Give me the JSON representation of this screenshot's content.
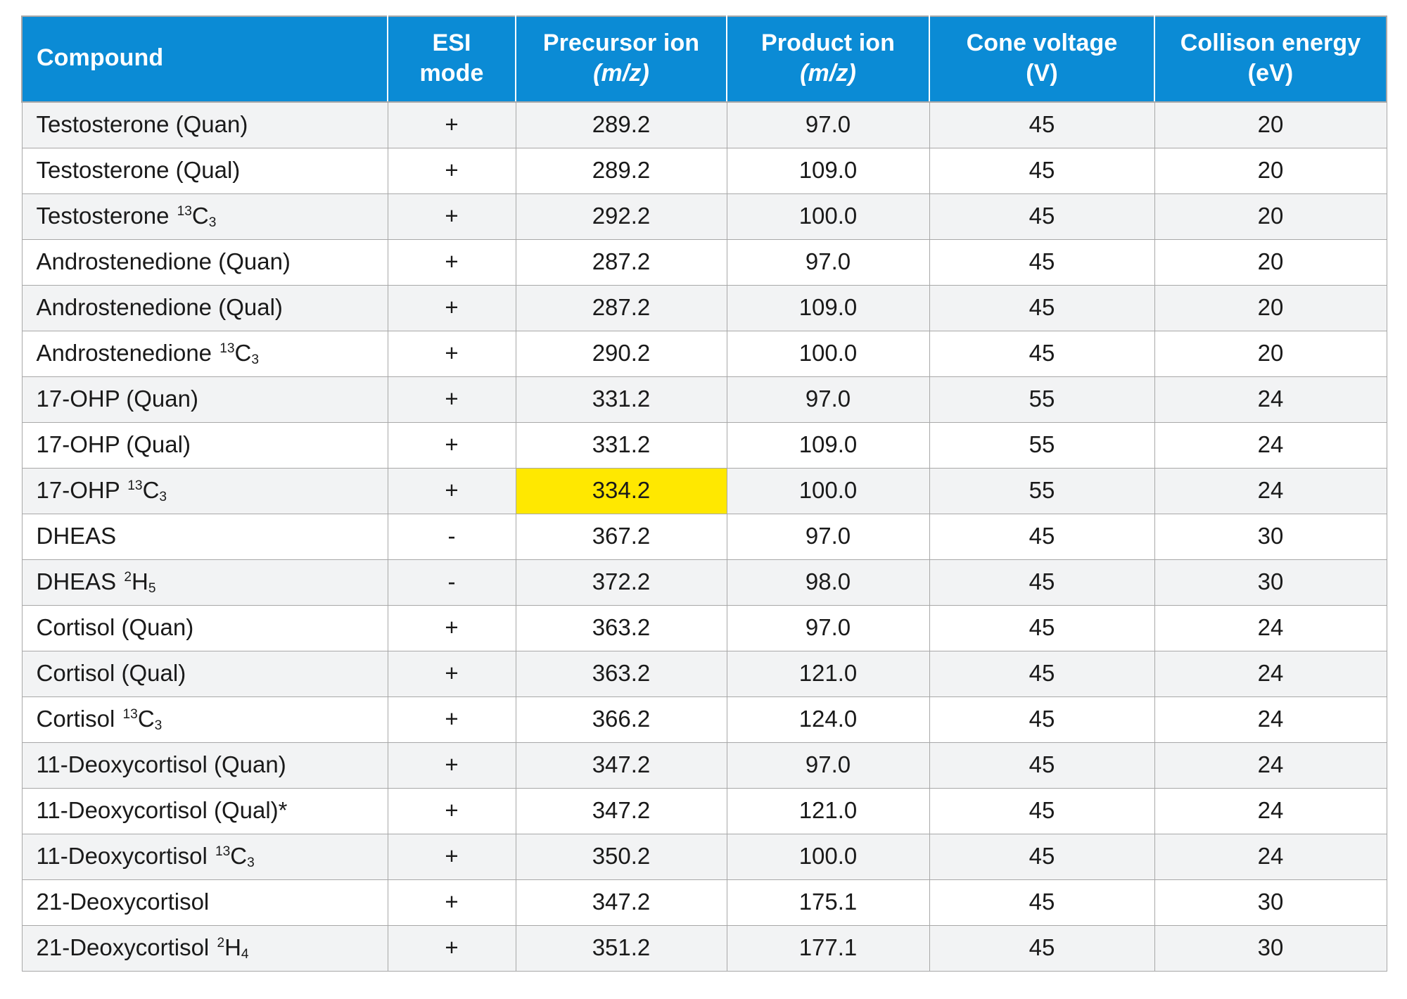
{
  "table": {
    "caption_note": "",
    "columns": [
      {
        "id": "compound",
        "label": "Compound",
        "sublabel": ""
      },
      {
        "id": "esi_mode",
        "label": "ESI",
        "sublabel": "mode"
      },
      {
        "id": "precursor_ion",
        "label": "Precursor ion",
        "sublabel": "(m/z)"
      },
      {
        "id": "product_ion",
        "label": "Product ion",
        "sublabel": "(m/z)"
      },
      {
        "id": "cone_voltage",
        "label": "Cone voltage",
        "sublabel": "(V)"
      },
      {
        "id": "collision_energy",
        "label": "Collison energy",
        "sublabel": "(eV)"
      }
    ],
    "rows": [
      {
        "compound": "Testosterone (Quan)",
        "compound_base": "Testosterone (Quan)",
        "isotope_sup": "",
        "isotope_el": "",
        "isotope_sub": "",
        "esi_mode": "+",
        "precursor_ion": "289.2",
        "product_ion": "97.0",
        "cone_voltage": "45",
        "collision_energy": "20",
        "highlight": ""
      },
      {
        "compound": "Testosterone (Qual)",
        "compound_base": "Testosterone (Qual)",
        "isotope_sup": "",
        "isotope_el": "",
        "isotope_sub": "",
        "esi_mode": "+",
        "precursor_ion": "289.2",
        "product_ion": "109.0",
        "cone_voltage": "45",
        "collision_energy": "20",
        "highlight": ""
      },
      {
        "compound": "Testosterone 13C3",
        "compound_base": "Testosterone ",
        "isotope_sup": "13",
        "isotope_el": "C",
        "isotope_sub": "3",
        "esi_mode": "+",
        "precursor_ion": "292.2",
        "product_ion": "100.0",
        "cone_voltage": "45",
        "collision_energy": "20",
        "highlight": ""
      },
      {
        "compound": "Androstenedione (Quan)",
        "compound_base": "Androstenedione (Quan)",
        "isotope_sup": "",
        "isotope_el": "",
        "isotope_sub": "",
        "esi_mode": "+",
        "precursor_ion": "287.2",
        "product_ion": "97.0",
        "cone_voltage": "45",
        "collision_energy": "20",
        "highlight": ""
      },
      {
        "compound": "Androstenedione (Qual)",
        "compound_base": "Androstenedione (Qual)",
        "isotope_sup": "",
        "isotope_el": "",
        "isotope_sub": "",
        "esi_mode": "+",
        "precursor_ion": "287.2",
        "product_ion": "109.0",
        "cone_voltage": "45",
        "collision_energy": "20",
        "highlight": ""
      },
      {
        "compound": "Androstenedione 13C3",
        "compound_base": "Androstenedione ",
        "isotope_sup": "13",
        "isotope_el": "C",
        "isotope_sub": "3",
        "esi_mode": "+",
        "precursor_ion": "290.2",
        "product_ion": "100.0",
        "cone_voltage": "45",
        "collision_energy": "20",
        "highlight": ""
      },
      {
        "compound": "17-OHP (Quan)",
        "compound_base": "17-OHP (Quan)",
        "isotope_sup": "",
        "isotope_el": "",
        "isotope_sub": "",
        "esi_mode": "+",
        "precursor_ion": "331.2",
        "product_ion": "97.0",
        "cone_voltage": "55",
        "collision_energy": "24",
        "highlight": ""
      },
      {
        "compound": "17-OHP (Qual)",
        "compound_base": "17-OHP (Qual)",
        "isotope_sup": "",
        "isotope_el": "",
        "isotope_sub": "",
        "esi_mode": "+",
        "precursor_ion": "331.2",
        "product_ion": "109.0",
        "cone_voltage": "55",
        "collision_energy": "24",
        "highlight": ""
      },
      {
        "compound": "17-OHP 13C3",
        "compound_base": "17-OHP ",
        "isotope_sup": "13",
        "isotope_el": "C",
        "isotope_sub": "3",
        "esi_mode": "+",
        "precursor_ion": "334.2",
        "product_ion": "100.0",
        "cone_voltage": "55",
        "collision_energy": "24",
        "highlight": "precursor_ion"
      },
      {
        "compound": "DHEAS",
        "compound_base": "DHEAS",
        "isotope_sup": "",
        "isotope_el": "",
        "isotope_sub": "",
        "esi_mode": "-",
        "precursor_ion": "367.2",
        "product_ion": "97.0",
        "cone_voltage": "45",
        "collision_energy": "30",
        "highlight": ""
      },
      {
        "compound": "DHEAS 2H5",
        "compound_base": "DHEAS ",
        "isotope_sup": "2",
        "isotope_el": "H",
        "isotope_sub": "5",
        "esi_mode": "-",
        "precursor_ion": "372.2",
        "product_ion": "98.0",
        "cone_voltage": "45",
        "collision_energy": "30",
        "highlight": ""
      },
      {
        "compound": "Cortisol (Quan)",
        "compound_base": "Cortisol (Quan)",
        "isotope_sup": "",
        "isotope_el": "",
        "isotope_sub": "",
        "esi_mode": "+",
        "precursor_ion": "363.2",
        "product_ion": "97.0",
        "cone_voltage": "45",
        "collision_energy": "24",
        "highlight": ""
      },
      {
        "compound": "Cortisol (Qual)",
        "compound_base": "Cortisol (Qual)",
        "isotope_sup": "",
        "isotope_el": "",
        "isotope_sub": "",
        "esi_mode": "+",
        "precursor_ion": "363.2",
        "product_ion": "121.0",
        "cone_voltage": "45",
        "collision_energy": "24",
        "highlight": ""
      },
      {
        "compound": "Cortisol 13C3",
        "compound_base": "Cortisol ",
        "isotope_sup": "13",
        "isotope_el": "C",
        "isotope_sub": "3",
        "esi_mode": "+",
        "precursor_ion": "366.2",
        "product_ion": "124.0",
        "cone_voltage": "45",
        "collision_energy": "24",
        "highlight": ""
      },
      {
        "compound": "11-Deoxycortisol (Quan)",
        "compound_base": "11-Deoxycortisol (Quan)",
        "isotope_sup": "",
        "isotope_el": "",
        "isotope_sub": "",
        "esi_mode": "+",
        "precursor_ion": "347.2",
        "product_ion": "97.0",
        "cone_voltage": "45",
        "collision_energy": "24",
        "highlight": ""
      },
      {
        "compound": "11-Deoxycortisol (Qual)*",
        "compound_base": "11-Deoxycortisol (Qual)*",
        "isotope_sup": "",
        "isotope_el": "",
        "isotope_sub": "",
        "esi_mode": "+",
        "precursor_ion": "347.2",
        "product_ion": "121.0",
        "cone_voltage": "45",
        "collision_energy": "24",
        "highlight": ""
      },
      {
        "compound": "11-Deoxycortisol 13C3",
        "compound_base": "11-Deoxycortisol ",
        "isotope_sup": "13",
        "isotope_el": "C",
        "isotope_sub": "3",
        "esi_mode": "+",
        "precursor_ion": "350.2",
        "product_ion": "100.0",
        "cone_voltage": "45",
        "collision_energy": "24",
        "highlight": ""
      },
      {
        "compound": "21-Deoxycortisol",
        "compound_base": "21-Deoxycortisol",
        "isotope_sup": "",
        "isotope_el": "",
        "isotope_sub": "",
        "esi_mode": "+",
        "precursor_ion": "347.2",
        "product_ion": "175.1",
        "cone_voltage": "45",
        "collision_energy": "30",
        "highlight": ""
      },
      {
        "compound": "21-Deoxycortisol 2H4",
        "compound_base": "21-Deoxycortisol ",
        "isotope_sup": "2",
        "isotope_el": "H",
        "isotope_sub": "4",
        "esi_mode": "+",
        "precursor_ion": "351.2",
        "product_ion": "177.1",
        "cone_voltage": "45",
        "collision_energy": "30",
        "highlight": ""
      }
    ]
  },
  "colors": {
    "header_background": "#0b8bd5",
    "header_text": "#ffffff",
    "grid_line": "#a8a8a8",
    "row_even_background": "#f2f3f4",
    "row_odd_background": "#ffffff",
    "highlight_background": "#ffe800",
    "body_text": "#1a1a1a"
  }
}
